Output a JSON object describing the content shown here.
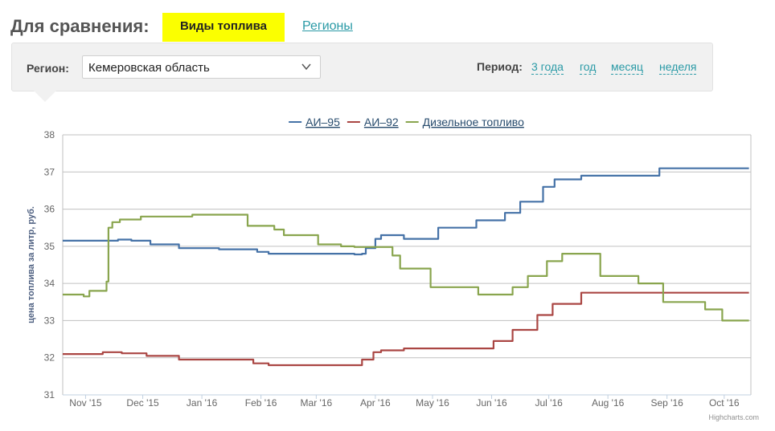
{
  "header": {
    "compare_label": "Для сравнения:",
    "tabs": [
      {
        "label": "Виды топлива",
        "active": true
      },
      {
        "label": "Регионы",
        "active": false
      }
    ],
    "active_color": "#fbff00",
    "link_color": "#2a9aa6"
  },
  "filters": {
    "region_label": "Регион:",
    "region_value": "Кемеровская область",
    "period_label": "Период:",
    "period_options": [
      "3 года",
      "год",
      "месяц",
      "неделя"
    ]
  },
  "chart_data": {
    "type": "line",
    "title": "",
    "ylabel": "цена топлива за литр, руб.",
    "xlabel": "",
    "ylim": [
      31,
      38
    ],
    "yticks": [
      31,
      32,
      33,
      34,
      35,
      36,
      37,
      38
    ],
    "xticks": [
      {
        "date": "2015-11-01",
        "label": "Nov '15"
      },
      {
        "date": "2015-12-01",
        "label": "Dec '15"
      },
      {
        "date": "2016-01-01",
        "label": "Jan '16"
      },
      {
        "date": "2016-02-01",
        "label": "Feb '16"
      },
      {
        "date": "2016-03-01",
        "label": "Mar '16"
      },
      {
        "date": "2016-04-01",
        "label": "Apr '16"
      },
      {
        "date": "2016-05-01",
        "label": "May '16"
      },
      {
        "date": "2016-06-01",
        "label": "Jun '16"
      },
      {
        "date": "2016-07-01",
        "label": "Jul '16"
      },
      {
        "date": "2016-08-01",
        "label": "Aug '16"
      },
      {
        "date": "2016-09-01",
        "label": "Sep '16"
      },
      {
        "date": "2016-10-01",
        "label": "Oct '16"
      }
    ],
    "xlim": [
      "2015-10-20",
      "2016-10-15"
    ],
    "grid": true,
    "legend": "top-center",
    "credit": "Highcharts.com",
    "series": [
      {
        "name": "АИ–95",
        "color": "#4572a7",
        "step": true,
        "points": [
          [
            "2015-10-20",
            35.15
          ],
          [
            "2015-11-08",
            35.15
          ],
          [
            "2015-11-18",
            35.18
          ],
          [
            "2015-11-25",
            35.15
          ],
          [
            "2015-12-05",
            35.05
          ],
          [
            "2015-12-20",
            34.95
          ],
          [
            "2016-01-10",
            34.92
          ],
          [
            "2016-01-30",
            34.85
          ],
          [
            "2016-02-05",
            34.8
          ],
          [
            "2016-03-21",
            34.78
          ],
          [
            "2016-03-25",
            34.8
          ],
          [
            "2016-03-27",
            34.95
          ],
          [
            "2016-04-01",
            35.2
          ],
          [
            "2016-04-04",
            35.3
          ],
          [
            "2016-04-16",
            35.2
          ],
          [
            "2016-05-04",
            35.5
          ],
          [
            "2016-05-24",
            35.7
          ],
          [
            "2016-06-08",
            35.9
          ],
          [
            "2016-06-16",
            36.2
          ],
          [
            "2016-06-28",
            36.6
          ],
          [
            "2016-07-04",
            36.8
          ],
          [
            "2016-07-18",
            36.9
          ],
          [
            "2016-08-28",
            37.1
          ],
          [
            "2016-10-14",
            37.1
          ]
        ]
      },
      {
        "name": "АИ–92",
        "color": "#aa4643",
        "step": true,
        "points": [
          [
            "2015-10-20",
            32.1
          ],
          [
            "2015-11-08",
            32.1
          ],
          [
            "2015-11-10",
            32.15
          ],
          [
            "2015-11-20",
            32.12
          ],
          [
            "2015-12-03",
            32.05
          ],
          [
            "2015-12-20",
            31.95
          ],
          [
            "2016-01-28",
            31.85
          ],
          [
            "2016-02-05",
            31.8
          ],
          [
            "2016-03-21",
            31.8
          ],
          [
            "2016-03-25",
            31.95
          ],
          [
            "2016-03-31",
            32.15
          ],
          [
            "2016-04-04",
            32.2
          ],
          [
            "2016-04-16",
            32.25
          ],
          [
            "2016-06-02",
            32.45
          ],
          [
            "2016-06-12",
            32.75
          ],
          [
            "2016-06-25",
            33.15
          ],
          [
            "2016-07-03",
            33.45
          ],
          [
            "2016-07-18",
            33.75
          ],
          [
            "2016-10-14",
            33.75
          ]
        ]
      },
      {
        "name": "Дизельное топливо",
        "color": "#89a54e",
        "step": true,
        "points": [
          [
            "2015-10-20",
            33.7
          ],
          [
            "2015-10-31",
            33.65
          ],
          [
            "2015-11-03",
            33.8
          ],
          [
            "2015-11-12",
            34.05
          ],
          [
            "2015-11-13",
            35.5
          ],
          [
            "2015-11-15",
            35.65
          ],
          [
            "2015-11-19",
            35.72
          ],
          [
            "2015-11-30",
            35.8
          ],
          [
            "2015-12-27",
            35.85
          ],
          [
            "2016-01-25",
            35.55
          ],
          [
            "2016-02-08",
            35.45
          ],
          [
            "2016-02-13",
            35.3
          ],
          [
            "2016-03-02",
            35.05
          ],
          [
            "2016-03-14",
            35.0
          ],
          [
            "2016-03-21",
            34.98
          ],
          [
            "2016-04-10",
            34.75
          ],
          [
            "2016-04-14",
            34.4
          ],
          [
            "2016-04-30",
            33.9
          ],
          [
            "2016-05-25",
            33.7
          ],
          [
            "2016-06-12",
            33.9
          ],
          [
            "2016-06-20",
            34.2
          ],
          [
            "2016-06-30",
            34.6
          ],
          [
            "2016-07-08",
            34.8
          ],
          [
            "2016-07-28",
            34.2
          ],
          [
            "2016-08-17",
            34.0
          ],
          [
            "2016-08-30",
            33.5
          ],
          [
            "2016-09-21",
            33.3
          ],
          [
            "2016-09-30",
            33.0
          ],
          [
            "2016-10-04",
            33.0
          ],
          [
            "2016-10-14",
            33.0
          ]
        ]
      }
    ]
  }
}
